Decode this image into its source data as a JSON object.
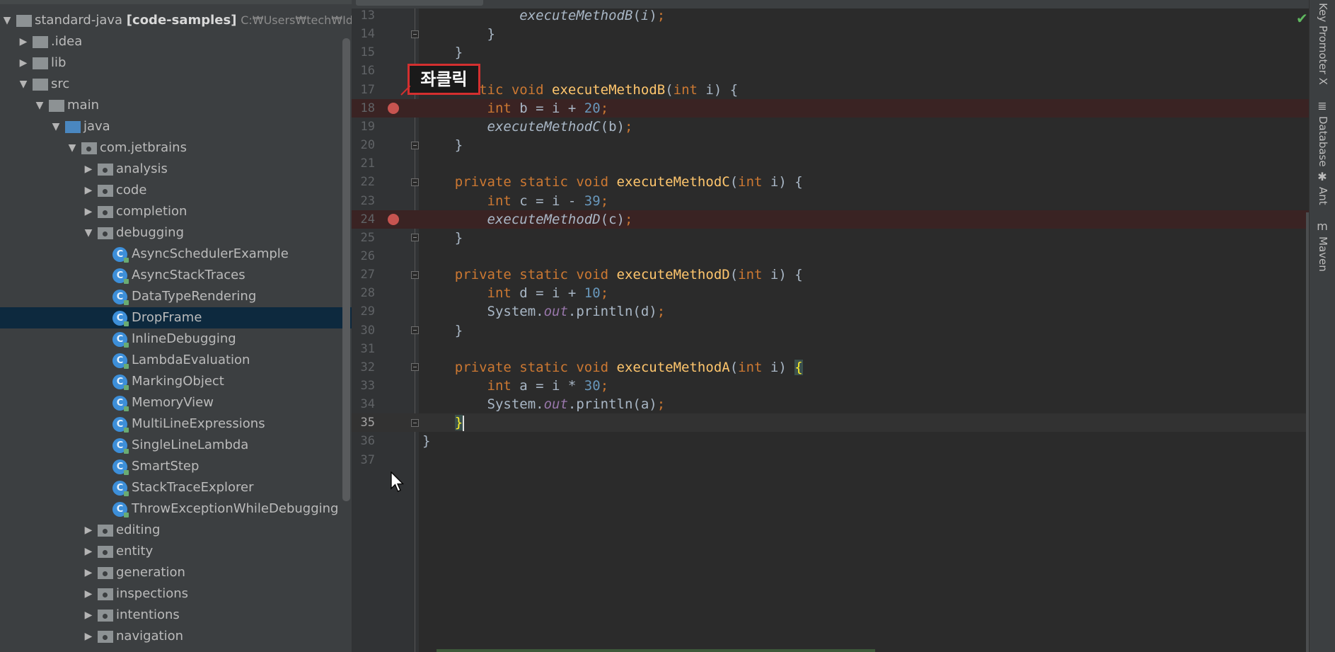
{
  "project_tree": {
    "rows": [
      {
        "label": "standard-java",
        "bold": "[code-samples]",
        "path": "C:₩Users₩tech₩IdeaPr",
        "depth": 0,
        "arrow": "down",
        "icon": "folder"
      },
      {
        "label": ".idea",
        "depth": 1,
        "arrow": "right",
        "icon": "folder"
      },
      {
        "label": "lib",
        "depth": 1,
        "arrow": "right",
        "icon": "folder"
      },
      {
        "label": "src",
        "depth": 1,
        "arrow": "down",
        "icon": "folder"
      },
      {
        "label": "main",
        "depth": 2,
        "arrow": "down",
        "icon": "folder"
      },
      {
        "label": "java",
        "depth": 3,
        "arrow": "down",
        "icon": "folder-blue"
      },
      {
        "label": "com.jetbrains",
        "depth": 4,
        "arrow": "down",
        "icon": "package"
      },
      {
        "label": "analysis",
        "depth": 5,
        "arrow": "right",
        "icon": "package"
      },
      {
        "label": "code",
        "depth": 5,
        "arrow": "right",
        "icon": "package"
      },
      {
        "label": "completion",
        "depth": 5,
        "arrow": "right",
        "icon": "package"
      },
      {
        "label": "debugging",
        "depth": 5,
        "arrow": "down",
        "icon": "package"
      },
      {
        "label": "AsyncSchedulerExample",
        "depth": 6,
        "icon": "class"
      },
      {
        "label": "AsyncStackTraces",
        "depth": 6,
        "icon": "class"
      },
      {
        "label": "DataTypeRendering",
        "depth": 6,
        "icon": "class"
      },
      {
        "label": "DropFrame",
        "depth": 6,
        "icon": "class",
        "selected": true
      },
      {
        "label": "InlineDebugging",
        "depth": 6,
        "icon": "class"
      },
      {
        "label": "LambdaEvaluation",
        "depth": 6,
        "icon": "class"
      },
      {
        "label": "MarkingObject",
        "depth": 6,
        "icon": "class"
      },
      {
        "label": "MemoryView",
        "depth": 6,
        "icon": "class"
      },
      {
        "label": "MultiLineExpressions",
        "depth": 6,
        "icon": "class"
      },
      {
        "label": "SingleLineLambda",
        "depth": 6,
        "icon": "class"
      },
      {
        "label": "SmartStep",
        "depth": 6,
        "icon": "class"
      },
      {
        "label": "StackTraceExplorer",
        "depth": 6,
        "icon": "class"
      },
      {
        "label": "ThrowExceptionWhileDebugging",
        "depth": 6,
        "icon": "class"
      },
      {
        "label": "editing",
        "depth": 5,
        "arrow": "right",
        "icon": "package"
      },
      {
        "label": "entity",
        "depth": 5,
        "arrow": "right",
        "icon": "package"
      },
      {
        "label": "generation",
        "depth": 5,
        "arrow": "right",
        "icon": "package"
      },
      {
        "label": "inspections",
        "depth": 5,
        "arrow": "right",
        "icon": "package"
      },
      {
        "label": "intentions",
        "depth": 5,
        "arrow": "right",
        "icon": "package"
      },
      {
        "label": "navigation",
        "depth": 5,
        "arrow": "right",
        "icon": "package"
      }
    ]
  },
  "editor": {
    "annotation_label": "좌클릭",
    "current_line": 35,
    "lines": [
      {
        "num": "13",
        "tokens": [
          {
            "t": "            "
          },
          {
            "t": "executeMethodB",
            "c": "it"
          },
          {
            "t": "("
          },
          {
            "t": "i",
            "c": "it"
          },
          {
            "t": ")"
          },
          {
            "t": ";",
            "c": "kw"
          }
        ]
      },
      {
        "num": "14",
        "fold": true,
        "tokens": [
          {
            "t": "        }"
          }
        ]
      },
      {
        "num": "15",
        "tokens": [
          {
            "t": "    }"
          }
        ]
      },
      {
        "num": "16",
        "tokens": []
      },
      {
        "num": "17",
        "fold": true,
        "tokens": [
          {
            "t": "    "
          },
          {
            "t": "static void ",
            "c": "kw"
          },
          {
            "t": "executeMethodB",
            "c": "fn"
          },
          {
            "t": "("
          },
          {
            "t": "int ",
            "c": "kw"
          },
          {
            "t": "i) {"
          }
        ]
      },
      {
        "num": "18",
        "breakpoint": true,
        "tokens": [
          {
            "t": "        "
          },
          {
            "t": "int ",
            "c": "kw"
          },
          {
            "t": "b = i + "
          },
          {
            "t": "20",
            "c": "num"
          },
          {
            "t": ";",
            "c": "kw"
          }
        ]
      },
      {
        "num": "19",
        "tokens": [
          {
            "t": "        "
          },
          {
            "t": "executeMethodC",
            "c": "it"
          },
          {
            "t": "(b)"
          },
          {
            "t": ";",
            "c": "kw"
          }
        ]
      },
      {
        "num": "20",
        "fold": true,
        "tokens": [
          {
            "t": "    }"
          }
        ]
      },
      {
        "num": "21",
        "tokens": []
      },
      {
        "num": "22",
        "fold": true,
        "tokens": [
          {
            "t": "    "
          },
          {
            "t": "private static void ",
            "c": "kw"
          },
          {
            "t": "executeMethodC",
            "c": "fn"
          },
          {
            "t": "("
          },
          {
            "t": "int ",
            "c": "kw"
          },
          {
            "t": "i) {"
          }
        ]
      },
      {
        "num": "23",
        "tokens": [
          {
            "t": "        "
          },
          {
            "t": "int ",
            "c": "kw"
          },
          {
            "t": "c = i - "
          },
          {
            "t": "39",
            "c": "num"
          },
          {
            "t": ";",
            "c": "kw"
          }
        ]
      },
      {
        "num": "24",
        "breakpoint": true,
        "tokens": [
          {
            "t": "        "
          },
          {
            "t": "executeMethodD",
            "c": "it"
          },
          {
            "t": "(c)"
          },
          {
            "t": ";",
            "c": "kw"
          }
        ]
      },
      {
        "num": "25",
        "fold": true,
        "tokens": [
          {
            "t": "    }"
          }
        ]
      },
      {
        "num": "26",
        "tokens": []
      },
      {
        "num": "27",
        "fold": true,
        "tokens": [
          {
            "t": "    "
          },
          {
            "t": "private static void ",
            "c": "kw"
          },
          {
            "t": "executeMethodD",
            "c": "fn"
          },
          {
            "t": "("
          },
          {
            "t": "int ",
            "c": "kw"
          },
          {
            "t": "i) {"
          }
        ]
      },
      {
        "num": "28",
        "tokens": [
          {
            "t": "        "
          },
          {
            "t": "int ",
            "c": "kw"
          },
          {
            "t": "d = i + "
          },
          {
            "t": "10",
            "c": "num"
          },
          {
            "t": ";",
            "c": "kw"
          }
        ]
      },
      {
        "num": "29",
        "tokens": [
          {
            "t": "        System."
          },
          {
            "t": "out",
            "c": "static-field"
          },
          {
            "t": ".println(d)"
          },
          {
            "t": ";",
            "c": "kw"
          }
        ]
      },
      {
        "num": "30",
        "fold": true,
        "tokens": [
          {
            "t": "    }"
          }
        ]
      },
      {
        "num": "31",
        "tokens": []
      },
      {
        "num": "32",
        "fold": true,
        "tokens": [
          {
            "t": "    "
          },
          {
            "t": "private static void ",
            "c": "kw"
          },
          {
            "t": "executeMethodA",
            "c": "fn"
          },
          {
            "t": "("
          },
          {
            "t": "int ",
            "c": "kw"
          },
          {
            "t": "i) "
          },
          {
            "t": "{",
            "c": "brace-hl"
          }
        ]
      },
      {
        "num": "33",
        "tokens": [
          {
            "t": "        "
          },
          {
            "t": "int ",
            "c": "kw"
          },
          {
            "t": "a = i * "
          },
          {
            "t": "30",
            "c": "num"
          },
          {
            "t": ";",
            "c": "kw"
          }
        ]
      },
      {
        "num": "34",
        "tokens": [
          {
            "t": "        System."
          },
          {
            "t": "out",
            "c": "static-field"
          },
          {
            "t": ".println(a)"
          },
          {
            "t": ";",
            "c": "kw"
          }
        ]
      },
      {
        "num": "35",
        "fold": true,
        "caret": true,
        "tokens": [
          {
            "t": "    "
          },
          {
            "t": "}",
            "c": "brace-hl"
          }
        ]
      },
      {
        "num": "36",
        "tokens": [
          {
            "t": "}"
          }
        ]
      },
      {
        "num": "37",
        "tokens": []
      }
    ]
  },
  "right_toolbar": {
    "items": [
      {
        "label": "Key Promoter X",
        "icon": ""
      },
      {
        "label": "Database",
        "icon": "≣"
      },
      {
        "label": "Ant",
        "icon": "✱"
      },
      {
        "label": "Maven",
        "icon": "m"
      }
    ]
  }
}
